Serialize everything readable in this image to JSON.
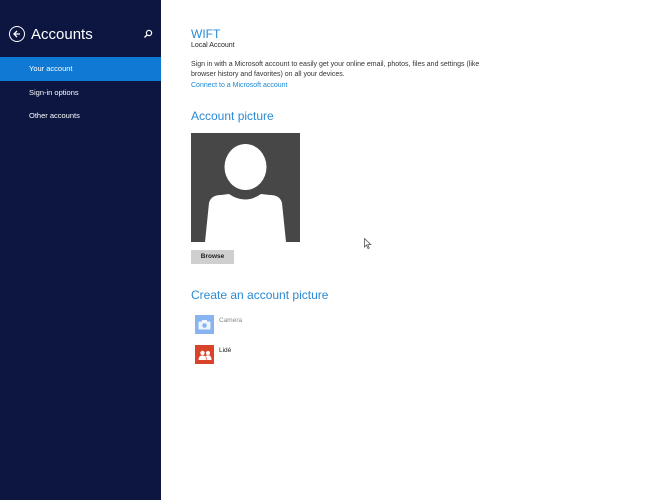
{
  "sidebar": {
    "title": "Accounts",
    "back_icon": "back-arrow-circle-icon",
    "search_icon": "search-icon",
    "items": [
      {
        "label": "Your account",
        "active": true
      },
      {
        "label": "Sign-in options",
        "active": false
      },
      {
        "label": "Other accounts",
        "active": false
      }
    ]
  },
  "account": {
    "name": "WIFT",
    "type": "Local Account",
    "description": "Sign in with a Microsoft account to easily get your online email, photos, files and settings (like browser history and favorites) on all your devices.",
    "connect_link": "Connect to a Microsoft account"
  },
  "picture": {
    "title": "Account picture",
    "browse_label": "Browse"
  },
  "create": {
    "title": "Create an account picture",
    "options": [
      {
        "label": "Camera",
        "icon": "camera-icon",
        "color": "#88b4f0",
        "enabled": false
      },
      {
        "label": "Lidé",
        "icon": "people-icon",
        "color": "#d9432a",
        "enabled": true
      }
    ]
  },
  "colors": {
    "sidebar_bg": "#0c1640",
    "active_item": "#0f79d3",
    "accent_text": "#2a8ad4"
  }
}
